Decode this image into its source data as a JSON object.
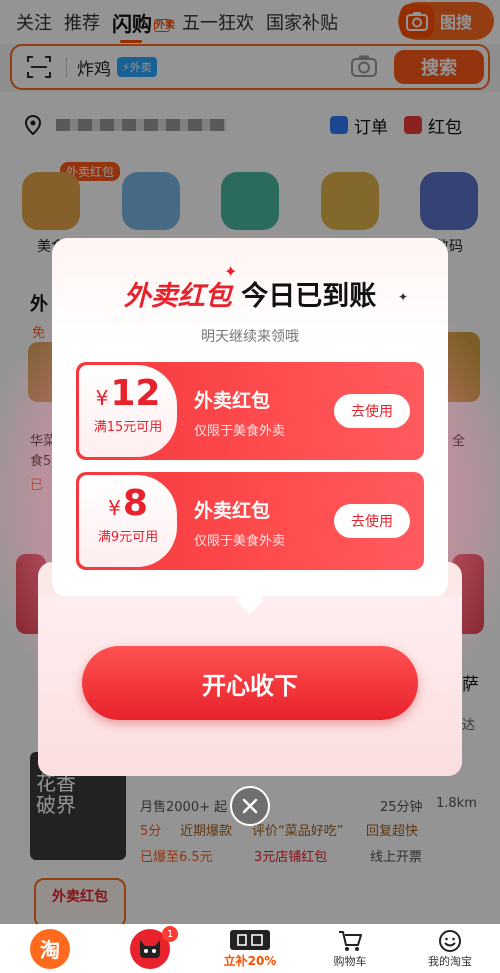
{
  "topnav": {
    "tabs": [
      {
        "label": "关注"
      },
      {
        "label": "推荐"
      },
      {
        "label": "闪购",
        "sub": "外卖"
      },
      {
        "label": "五一狂欢"
      },
      {
        "label": "国家补贴"
      }
    ],
    "image_search_label": "图搜"
  },
  "search": {
    "query": "炸鸡",
    "tag": "外卖",
    "button": "搜索"
  },
  "background": {
    "order_label": "订单",
    "redpacket_label": "红包",
    "category_tag": "外卖红包",
    "categories": [
      "美食",
      "",
      "",
      "",
      "数码"
    ],
    "partial_labels": {
      "left_heading": "外",
      "left_free": "免",
      "left_name": "华菜",
      "left_name2": "食5",
      "left_status": "已",
      "right_name": "全",
      "right_pizza": "萨",
      "right_tai": "达"
    },
    "shop_thumb_text": "花香破界",
    "shop_meta": "月售2000+  起",
    "shop_tags": [
      "近期爆款",
      "评价“菜品好吃”",
      "回复超快"
    ],
    "shop_sold": "已爆至6.5元",
    "shop_coupon": "3元店铺红包",
    "shop_pay": "线上开票",
    "shop_distance": "1.8km",
    "shop_time": "25分钟",
    "shop_rating": "5分",
    "bottom_card_label": "外卖红包"
  },
  "popup": {
    "title_red": "外卖红包",
    "title_black": "今日已到账",
    "subtitle": "明天继续来领哦",
    "coupons": [
      {
        "currency": "¥",
        "amount": "12",
        "condition": "满15元可用",
        "name": "外卖红包",
        "desc": "仅限于美食外卖",
        "button": "去使用"
      },
      {
        "currency": "¥",
        "amount": "8",
        "condition": "满9元可用",
        "name": "外卖红包",
        "desc": "仅限于美食外卖",
        "button": "去使用"
      }
    ],
    "accept_button": "开心收下"
  },
  "tabbar": {
    "items": [
      {
        "label": "",
        "icon": "taobao-logo-icon"
      },
      {
        "label": "",
        "icon": "tmall-cat-icon",
        "badge": "1"
      },
      {
        "label": "立补20%",
        "icon": "subsidy-icon"
      },
      {
        "label": "购物车",
        "icon": "cart-icon"
      },
      {
        "label": "我的淘宝",
        "icon": "smiley-icon"
      }
    ],
    "taobao_glyph": "淘"
  },
  "colors": {
    "accent": "#ff5000",
    "coupon_red": "#e8222c",
    "info_blue": "#2aa7ff"
  }
}
